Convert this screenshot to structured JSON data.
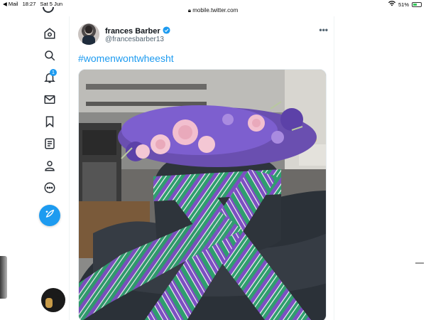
{
  "statusbar": {
    "back_app": "◀ Mail",
    "time": "18:27",
    "date": "Sat 5 Jun",
    "url": "mobile.twitter.com",
    "battery": "51%"
  },
  "sidebar": {
    "notifications_count": "1"
  },
  "tweet": {
    "display_name": "frances Barber",
    "handle": "@francesbarber13",
    "hashtag": "#womenwontwheesht",
    "more": "•••"
  },
  "colors": {
    "accent": "#1d9bf0",
    "text_primary": "#0f1419",
    "text_secondary": "#536471"
  },
  "icons": {
    "home": "home-icon",
    "explore": "search-icon",
    "notifications": "bell-icon",
    "messages": "mail-icon",
    "bookmarks": "bookmark-icon",
    "lists": "list-icon",
    "profile": "person-icon",
    "more": "more-circle-icon",
    "compose": "compose-feather-icon"
  }
}
